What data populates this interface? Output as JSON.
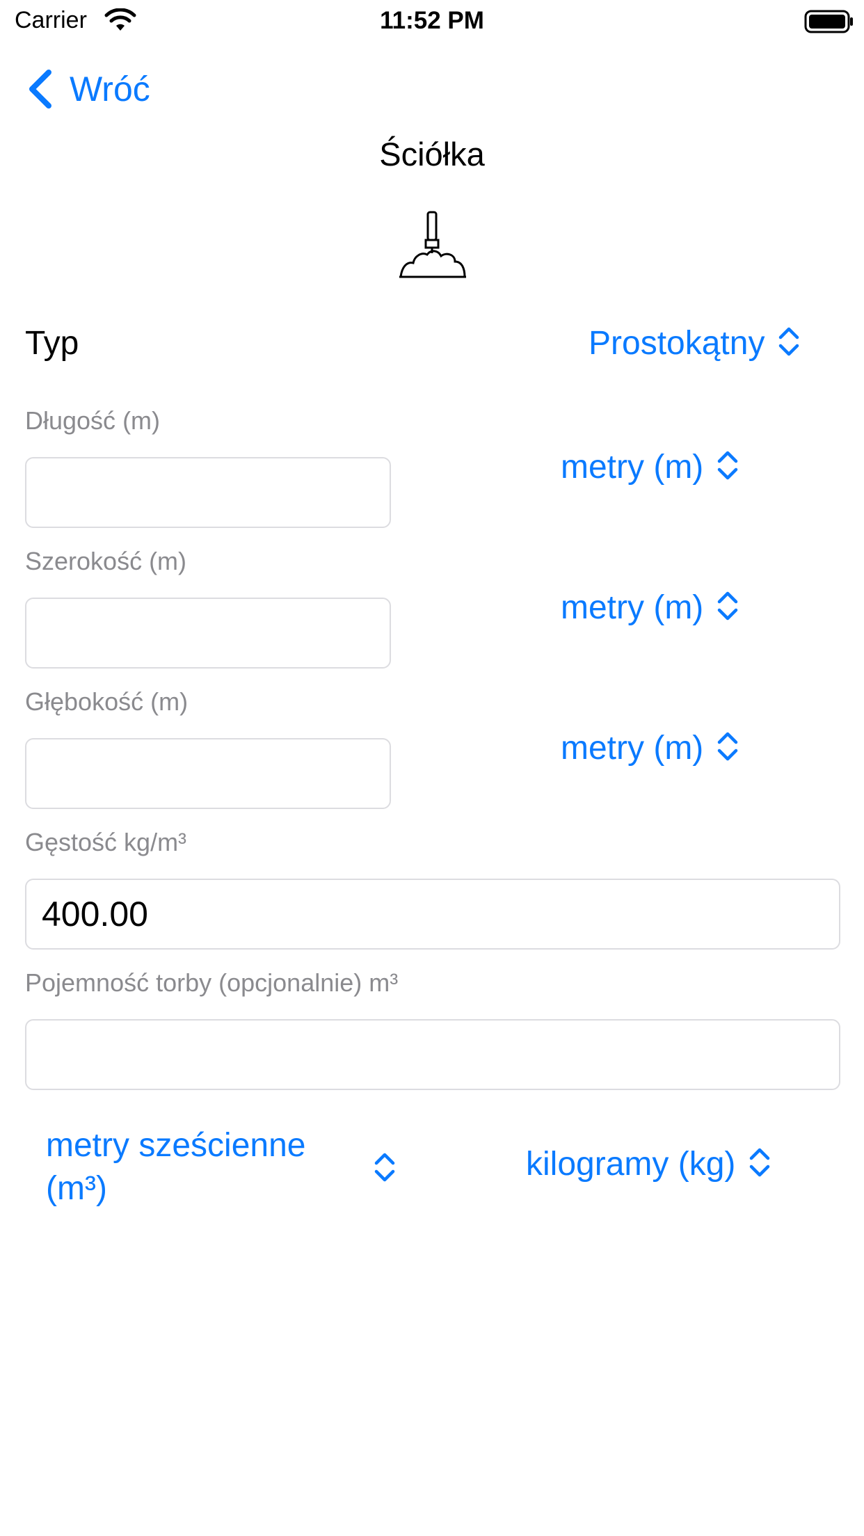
{
  "status_bar": {
    "carrier": "Carrier",
    "time": "11:52 PM",
    "icons": [
      "wifi-icon",
      "battery-icon"
    ]
  },
  "nav": {
    "back_label": "Wróć",
    "back_icon": "chevron-left-icon"
  },
  "title": "Ściółka",
  "header_icon": "mulch-shovel-icon",
  "type_row": {
    "label": "Typ",
    "value": "Prostokątny"
  },
  "fields": [
    {
      "label": "Długość (m)",
      "value": "",
      "unit": "metry (m)"
    },
    {
      "label": "Szerokość (m)",
      "value": "",
      "unit": "metry (m)"
    },
    {
      "label": "Głębokość (m)",
      "value": "",
      "unit": "metry (m)"
    }
  ],
  "density": {
    "label": "Gęstość kg/m³",
    "value": "400.00"
  },
  "bag_capacity": {
    "label": "Pojemność torby (opcjonalnie) m³",
    "value": ""
  },
  "result_units": {
    "volume": "metry sześcienne (m³)",
    "weight": "kilogramy (kg)"
  },
  "colors": {
    "accent": "#0a7aff",
    "label_gray": "#8a8a8e",
    "input_border": "#dcdce0"
  }
}
